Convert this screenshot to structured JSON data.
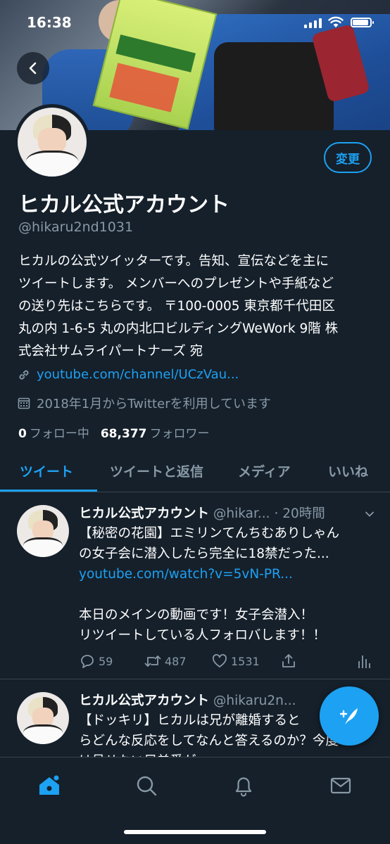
{
  "status_bar": {
    "time": "16:38"
  },
  "profile": {
    "display_name": "ヒカル公式アカウント",
    "handle": "@hikaru2nd1031",
    "edit_label": "変更",
    "bio_lines": [
      "ヒカルの公式ツイッターです。告知、宣伝などを主に",
      "ツイートします。 メンバーへのプレゼントや手紙など",
      "の送り先はこちらです。 〒100-0005 東京都千代田区",
      "丸の内 1-6-5 丸の内北口ビルディングWeWork 9階 株",
      "式会社サムライパートナーズ 宛"
    ],
    "link": "youtube.com/channel/UCzVau...",
    "joined": "2018年1月からTwitterを利用しています",
    "following_count": "0",
    "following_label": "フォロー中",
    "followers_count": "68,377",
    "followers_label": "フォロワー"
  },
  "tabs": [
    {
      "label": "ツイート",
      "active": true
    },
    {
      "label": "ツイートと返信",
      "active": false
    },
    {
      "label": "メディア",
      "active": false
    },
    {
      "label": "いいね",
      "active": false
    }
  ],
  "tweets": [
    {
      "name": "ヒカル公式アカウント",
      "handle": "@hikar...",
      "time": "· 20時間",
      "line1": "【秘密の花園】エミリンてんちむありしゃん",
      "line2": "の女子会に潜入したら完全に18禁だった...",
      "link": "youtube.com/watch?v=5vN-PR...",
      "line3": "本日のメインの動画です！女子会潜入！",
      "line4": "リツイートしている人フォロバします！！",
      "replies": "59",
      "retweets": "487",
      "likes": "1531"
    },
    {
      "name": "ヒカル公式アカウント",
      "handle": "@hikaru2n...",
      "line1": "【ドッキリ】ヒカルは兄が離婚すると",
      "line2": "らどんな反応をしてなんと答えるのか？今度",
      "line3": "は見せない兄弟愛が..."
    }
  ],
  "icons": {
    "back": "arrow-left-icon",
    "link": "link-icon",
    "calendar": "calendar-icon",
    "reply": "reply-icon",
    "retweet": "retweet-icon",
    "like": "heart-icon",
    "share": "share-icon",
    "analytics": "analytics-icon",
    "compose": "compose-tweet-icon",
    "nav": [
      "home-icon",
      "search-icon",
      "notifications-icon",
      "messages-icon"
    ]
  },
  "colors": {
    "background": "#15202b",
    "accent": "#1da1f2",
    "muted": "#8899a6",
    "divider": "#38444d"
  }
}
